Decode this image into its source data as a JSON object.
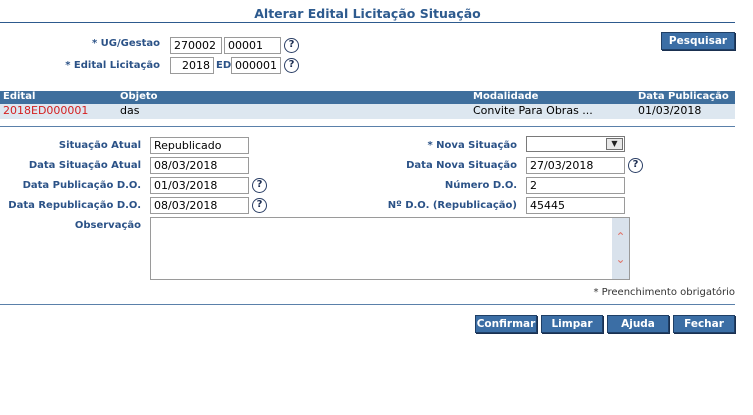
{
  "header": {
    "title": "Alterar Edital Licitação Situação"
  },
  "search": {
    "ug_label": "* UG/Gestao",
    "ug_value": "270002",
    "gestao_value": "00001",
    "edital_label": "* Edital Licitação",
    "edital_year": "2018",
    "ed_label": "ED",
    "edital_number": "000001",
    "search_button": "Pesquisar",
    "help_glyph": "?"
  },
  "grid": {
    "columns": [
      "Edital",
      "Objeto",
      "Modalidade",
      "Data Publicação"
    ],
    "rows": [
      {
        "edital": "2018ED000001",
        "objeto": "das",
        "modalidade": "Convite Para Obras ...",
        "data_publicacao": "01/03/2018"
      }
    ]
  },
  "form": {
    "situacao_atual_label": "Situação Atual",
    "situacao_atual_value": "Republicado",
    "data_situacao_atual_label": "Data Situação Atual",
    "data_situacao_atual_value": "08/03/2018",
    "data_publicacao_label": "Data Publicação D.O.",
    "data_publicacao_value": "01/03/2018",
    "data_republicacao_label": "Data Republicação D.O.",
    "data_republicacao_value": "08/03/2018",
    "observacao_label": "Observação",
    "observacao_value": "",
    "nova_situacao_label": "* Nova Situação",
    "nova_situacao_value": "",
    "data_nova_situacao_label": "Data Nova Situação",
    "data_nova_situacao_value": "27/03/2018",
    "numero_do_label": "Número D.O.",
    "numero_do_value": "2",
    "numero_do_republicacao_label": "Nº D.O. (Republicação)",
    "numero_do_republicacao_value": "45445",
    "required_note": "* Preenchimento obrigatório"
  },
  "actions": {
    "confirmar": "Confirmar",
    "limpar": "Limpar",
    "ajuda": "Ajuda",
    "fechar": "Fechar"
  },
  "colors": {
    "accent": "#3b6ea5",
    "label": "#2b5287",
    "grid_header": "#3f6f9d",
    "grid_row": "#dde7f0",
    "edital_link": "#d42020"
  }
}
